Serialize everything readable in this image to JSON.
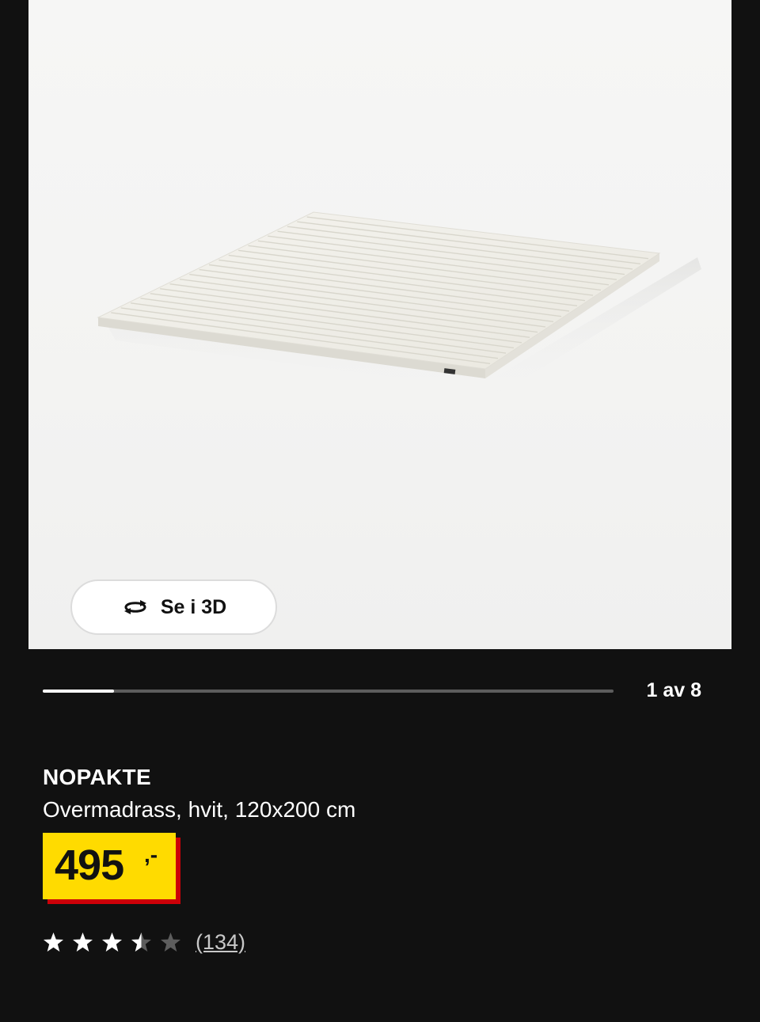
{
  "product_image": {
    "icon": "mattress-topper-photo",
    "background": "#f4f4f3"
  },
  "viewer": {
    "button_label": "Se i 3D",
    "icon": "rotate-3d-icon"
  },
  "gallery": {
    "current": 1,
    "total": 8,
    "counter_label": "1 av 8",
    "progress_fraction": 0.125
  },
  "product": {
    "name": "NOPAKTE",
    "description": "Overmadrass, hvit, 120x200 cm",
    "price": "495",
    "price_suffix": ",-",
    "price_colors": {
      "tag": "#ffdb00",
      "shadow": "#cc0008"
    }
  },
  "rating": {
    "stars": 3.5,
    "max_stars": 5,
    "review_count": "(134)"
  },
  "colors": {
    "panel": "#111111",
    "text": "#ffffff",
    "muted": "#5d5d5d"
  }
}
